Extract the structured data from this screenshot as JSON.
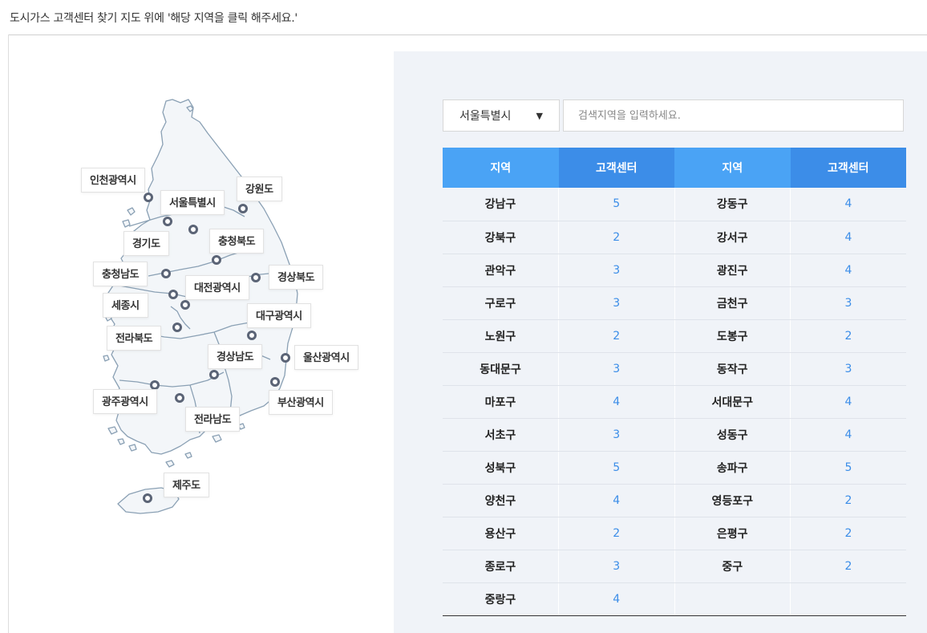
{
  "header": {
    "instruction": "도시가스 고객센터 찾기 지도 위에 '해당 지역을 클릭 해주세요.'"
  },
  "map": {
    "regions": [
      {
        "key": "incheon",
        "label": "인천광역시"
      },
      {
        "key": "seoul",
        "label": "서울특별시"
      },
      {
        "key": "gangwon",
        "label": "강원도"
      },
      {
        "key": "gyeonggi",
        "label": "경기도"
      },
      {
        "key": "chungbuk",
        "label": "충청북도"
      },
      {
        "key": "chungnam",
        "label": "충청남도"
      },
      {
        "key": "daejeon",
        "label": "대전광역시"
      },
      {
        "key": "gyeongbuk",
        "label": "경상북도"
      },
      {
        "key": "sejong",
        "label": "세종시"
      },
      {
        "key": "daegu",
        "label": "대구광역시"
      },
      {
        "key": "jeonbuk",
        "label": "전라북도"
      },
      {
        "key": "gyeongnam",
        "label": "경상남도"
      },
      {
        "key": "ulsan",
        "label": "울산광역시"
      },
      {
        "key": "gwangju",
        "label": "광주광역시"
      },
      {
        "key": "busan",
        "label": "부산광역시"
      },
      {
        "key": "jeonnam",
        "label": "전라남도"
      },
      {
        "key": "jeju",
        "label": "제주도"
      }
    ],
    "map_fill": "#f3f6f9",
    "map_stroke": "#8aa0b4",
    "pin_color": "#5b6476"
  },
  "search": {
    "selected_region": "서울특별시",
    "placeholder": "검색지역을 입력하세요."
  },
  "table": {
    "headers": [
      "지역",
      "고객센터",
      "지역",
      "고객센터"
    ],
    "rows": [
      [
        "강남구",
        "5",
        "강동구",
        "4"
      ],
      [
        "강북구",
        "2",
        "강서구",
        "4"
      ],
      [
        "관악구",
        "3",
        "광진구",
        "4"
      ],
      [
        "구로구",
        "3",
        "금천구",
        "3"
      ],
      [
        "노원구",
        "2",
        "도봉구",
        "2"
      ],
      [
        "동대문구",
        "3",
        "동작구",
        "3"
      ],
      [
        "마포구",
        "4",
        "서대문구",
        "4"
      ],
      [
        "서초구",
        "3",
        "성동구",
        "4"
      ],
      [
        "성북구",
        "5",
        "송파구",
        "5"
      ],
      [
        "양천구",
        "4",
        "영등포구",
        "2"
      ],
      [
        "용산구",
        "2",
        "은평구",
        "2"
      ],
      [
        "종로구",
        "3",
        "중구",
        "2"
      ],
      [
        "중랑구",
        "4",
        "",
        ""
      ]
    ],
    "header_color_light": "#4aa3f5",
    "header_color_dark": "#3c8de8",
    "count_color": "#3b8de8"
  }
}
